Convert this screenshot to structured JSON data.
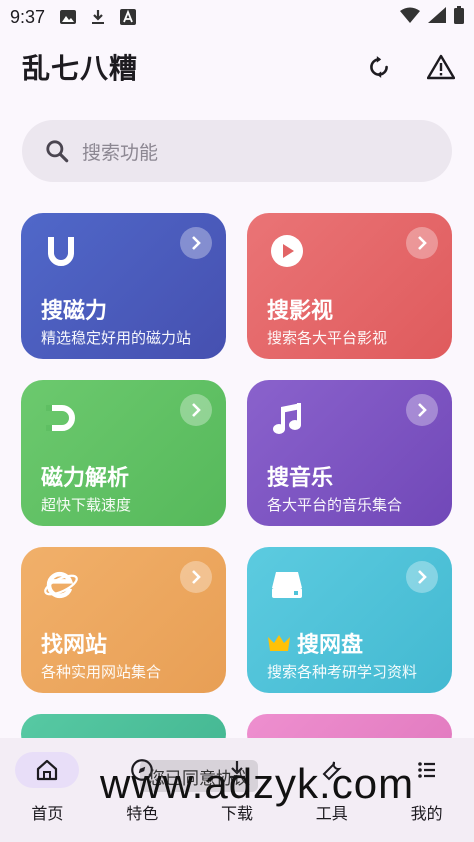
{
  "status": {
    "time": "9:37"
  },
  "header": {
    "title": "乱七八糟"
  },
  "search": {
    "placeholder": "搜索功能"
  },
  "cards": [
    {
      "title": "搜磁力",
      "subtitle": "精选稳定好用的磁力站",
      "color": "#4a5bbf",
      "icon": "magnet-u-icon"
    },
    {
      "title": "搜影视",
      "subtitle": "搜索各大平台影视",
      "color": "#e26466",
      "icon": "play-icon"
    },
    {
      "title": "磁力解析",
      "subtitle": "超快下载速度",
      "color": "#5fbf63",
      "icon": "magnet-icon"
    },
    {
      "title": "搜音乐",
      "subtitle": "各大平台的音乐集合",
      "color": "#7e57c2",
      "icon": "music-note-icon"
    },
    {
      "title": "找网站",
      "subtitle": "各种实用网站集合",
      "color": "#eda65e",
      "icon": "browser-e-icon"
    },
    {
      "title": "搜网盘",
      "subtitle": "搜索各种考研学习资料",
      "color": "#4fc3d9",
      "icon": "drive-icon",
      "badge_icon": "crown-icon"
    }
  ],
  "toast": {
    "text": "您已同意协议"
  },
  "watermark": "www.adzyk.com",
  "nav": [
    {
      "label": "首页",
      "icon": "home-icon",
      "active": true
    },
    {
      "label": "特色",
      "icon": "compass-icon",
      "active": false
    },
    {
      "label": "下载",
      "icon": "download-icon",
      "active": false
    },
    {
      "label": "工具",
      "icon": "tools-icon",
      "active": false
    },
    {
      "label": "我的",
      "icon": "menu-icon",
      "active": false
    }
  ]
}
